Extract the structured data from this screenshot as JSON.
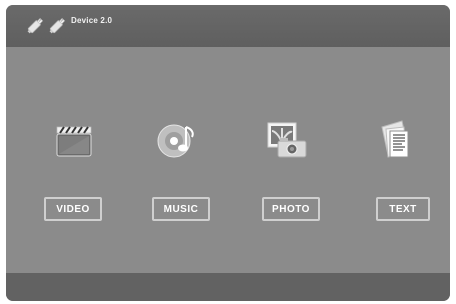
{
  "header": {
    "device_label": "Device 2.0",
    "icons": [
      "usb-drive-icon",
      "usb-drive-icon"
    ]
  },
  "menu": {
    "items": [
      {
        "id": "video",
        "label": "VIDEO",
        "icon": "clapperboard-icon"
      },
      {
        "id": "music",
        "label": "MUSIC",
        "icon": "music-disc-icon"
      },
      {
        "id": "photo",
        "label": "PHOTO",
        "icon": "photo-camera-icon"
      },
      {
        "id": "text",
        "label": "TEXT",
        "icon": "document-icon"
      }
    ]
  },
  "colors": {
    "background": "#8b8b8b",
    "topbar": "#636363",
    "bottombar": "#626262",
    "button_border": "#cfcfcf",
    "button_text": "#ffffff"
  }
}
